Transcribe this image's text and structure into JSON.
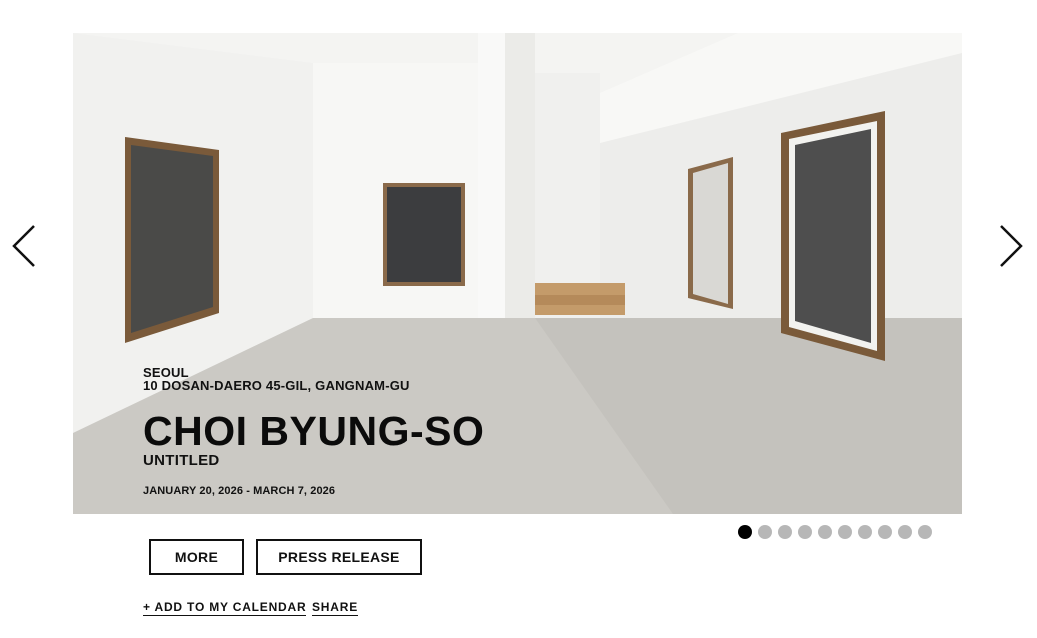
{
  "nav": {
    "prev_icon": "chevron-left-icon",
    "next_icon": "chevron-right-icon"
  },
  "exhibition": {
    "city": "SEOUL",
    "address": "10 DOSAN-DAERO 45-GIL, GANGNAM-GU",
    "artist": "CHOI BYUNG-SO",
    "title": "UNTITLED",
    "dates": "JANUARY 20, 2026 - MARCH 7, 2026"
  },
  "carousel": {
    "total_slides": 10,
    "active_index": 0
  },
  "actions": {
    "more_label": "MORE",
    "press_release_label": "PRESS RELEASE",
    "calendar_label": "+ ADD TO MY CALENDAR",
    "share_label": "SHARE"
  },
  "colors": {
    "text": "#111111",
    "dot_active": "#000000",
    "dot_inactive": "#b7b7b7",
    "wall": "#f3f3f1",
    "floor": "#c9c7c2"
  }
}
